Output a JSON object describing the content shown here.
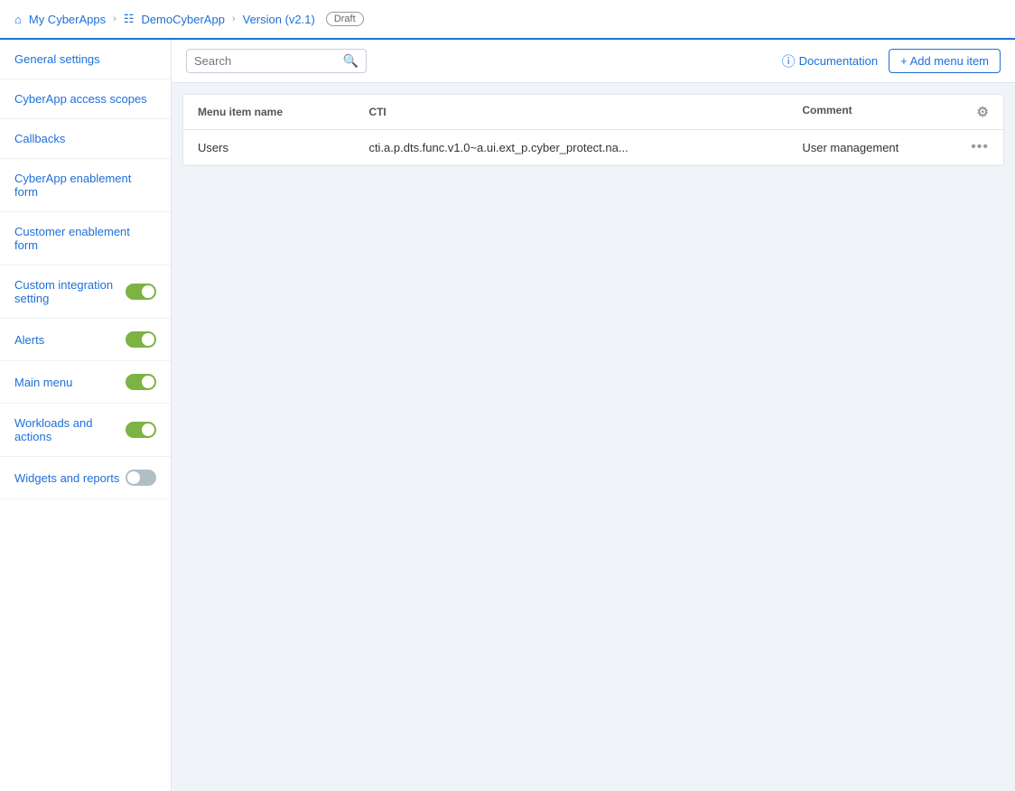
{
  "breadcrumb": {
    "items": [
      {
        "label": "My CyberApps",
        "icon": "home"
      },
      {
        "label": "DemoCyberApp",
        "icon": "apps"
      },
      {
        "label": "Version (v2.1)",
        "icon": null
      },
      {
        "label": "Draft",
        "badge": true
      }
    ]
  },
  "sidebar": {
    "items": [
      {
        "id": "general-settings",
        "label": "General settings",
        "toggle": null
      },
      {
        "id": "cyberapp-access-scopes",
        "label": "CyberApp access scopes",
        "toggle": null
      },
      {
        "id": "callbacks",
        "label": "Callbacks",
        "toggle": null
      },
      {
        "id": "cyberapp-enablement-form",
        "label": "CyberApp enablement form",
        "toggle": null
      },
      {
        "id": "customer-enablement-form",
        "label": "Customer enablement form",
        "toggle": null
      },
      {
        "id": "custom-integration-setting",
        "label": "Custom integration setting",
        "toggle": {
          "on": true
        }
      },
      {
        "id": "alerts",
        "label": "Alerts",
        "toggle": {
          "on": true
        }
      },
      {
        "id": "main-menu",
        "label": "Main menu",
        "toggle": {
          "on": true
        }
      },
      {
        "id": "workloads-and-actions",
        "label": "Workloads and actions",
        "toggle": {
          "on": true
        }
      },
      {
        "id": "widgets-and-reports",
        "label": "Widgets and reports",
        "toggle": {
          "on": false
        }
      }
    ]
  },
  "toolbar": {
    "search_placeholder": "Search",
    "doc_link_label": "Documentation",
    "add_btn_label": "+ Add menu item"
  },
  "table": {
    "columns": [
      {
        "id": "menu-item-name",
        "label": "Menu item name"
      },
      {
        "id": "cti",
        "label": "CTI"
      },
      {
        "id": "comment",
        "label": "Comment"
      }
    ],
    "rows": [
      {
        "menu_item_name": "Users",
        "cti": "cti.a.p.dts.func.v1.0~a.ui.ext_p.cyber_protect.na...",
        "comment": "User management"
      }
    ]
  }
}
